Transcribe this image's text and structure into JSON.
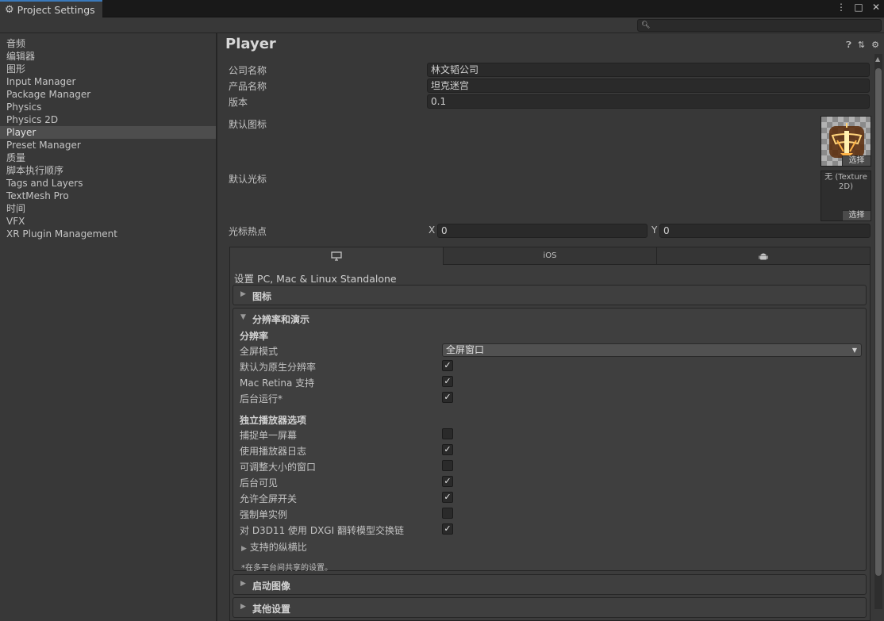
{
  "window": {
    "tab_title": "Project Settings",
    "controls": [
      "⋮",
      "□",
      "✕"
    ]
  },
  "search": {
    "placeholder": ""
  },
  "sidebar": {
    "items": [
      {
        "label": "音频"
      },
      {
        "label": "编辑器"
      },
      {
        "label": "图形"
      },
      {
        "label": "Input Manager"
      },
      {
        "label": "Package Manager"
      },
      {
        "label": "Physics"
      },
      {
        "label": "Physics 2D"
      },
      {
        "label": "Player",
        "selected": true
      },
      {
        "label": "Preset Manager"
      },
      {
        "label": "质量"
      },
      {
        "label": "脚本执行顺序"
      },
      {
        "label": "Tags and Layers"
      },
      {
        "label": "TextMesh Pro"
      },
      {
        "label": "时间"
      },
      {
        "label": "VFX"
      },
      {
        "label": "XR Plugin Management"
      }
    ]
  },
  "player": {
    "title": "Player",
    "company_label": "公司名称",
    "company_value": "林文韬公司",
    "product_label": "产品名称",
    "product_value": "坦克迷宫",
    "version_label": "版本",
    "version_value": "0.1",
    "default_icon_label": "默认图标",
    "default_cursor_label": "默认光标",
    "cursor_none_text": "无 (Texture 2D)",
    "select_label": "选择",
    "hotspot_label": "光标热点",
    "hotspot_x_label": "X",
    "hotspot_x_value": "0",
    "hotspot_y_label": "Y",
    "hotspot_y_value": "0"
  },
  "platforms": {
    "tabs": [
      {
        "label": "",
        "icon": "monitor-icon",
        "active": true
      },
      {
        "label": "iOS",
        "icon": "",
        "active": false
      },
      {
        "label": "",
        "icon": "android-icon",
        "active": false
      }
    ],
    "settings_title": "设置 PC, Mac & Linux Standalone",
    "foldouts": {
      "icon": "图标",
      "resolution": "分辨率和演示",
      "splash": "启动图像",
      "other": "其他设置"
    }
  },
  "resolution": {
    "resolution_header": "分辨率",
    "fullscreen_label": "全屏模式",
    "fullscreen_value": "全屏窗口",
    "options": [
      {
        "label": "默认为原生分辨率",
        "checked": true
      },
      {
        "label": "Mac Retina 支持",
        "checked": true
      },
      {
        "label": "后台运行*",
        "checked": true
      }
    ],
    "standalone_header": "独立播放器选项",
    "standalone_options": [
      {
        "label": "捕捉单一屏幕",
        "checked": false
      },
      {
        "label": "使用播放器日志",
        "checked": true
      },
      {
        "label": "可调整大小的窗口",
        "checked": false
      },
      {
        "label": "后台可见",
        "checked": true
      },
      {
        "label": "允许全屏开关",
        "checked": true
      },
      {
        "label": "强制单实例",
        "checked": false
      },
      {
        "label": "对 D3D11 使用 DXGI 翻转模型交换链",
        "checked": true
      }
    ],
    "aspect_label": "支持的纵横比",
    "shared_note": "*在多平台间共享的设置。"
  }
}
